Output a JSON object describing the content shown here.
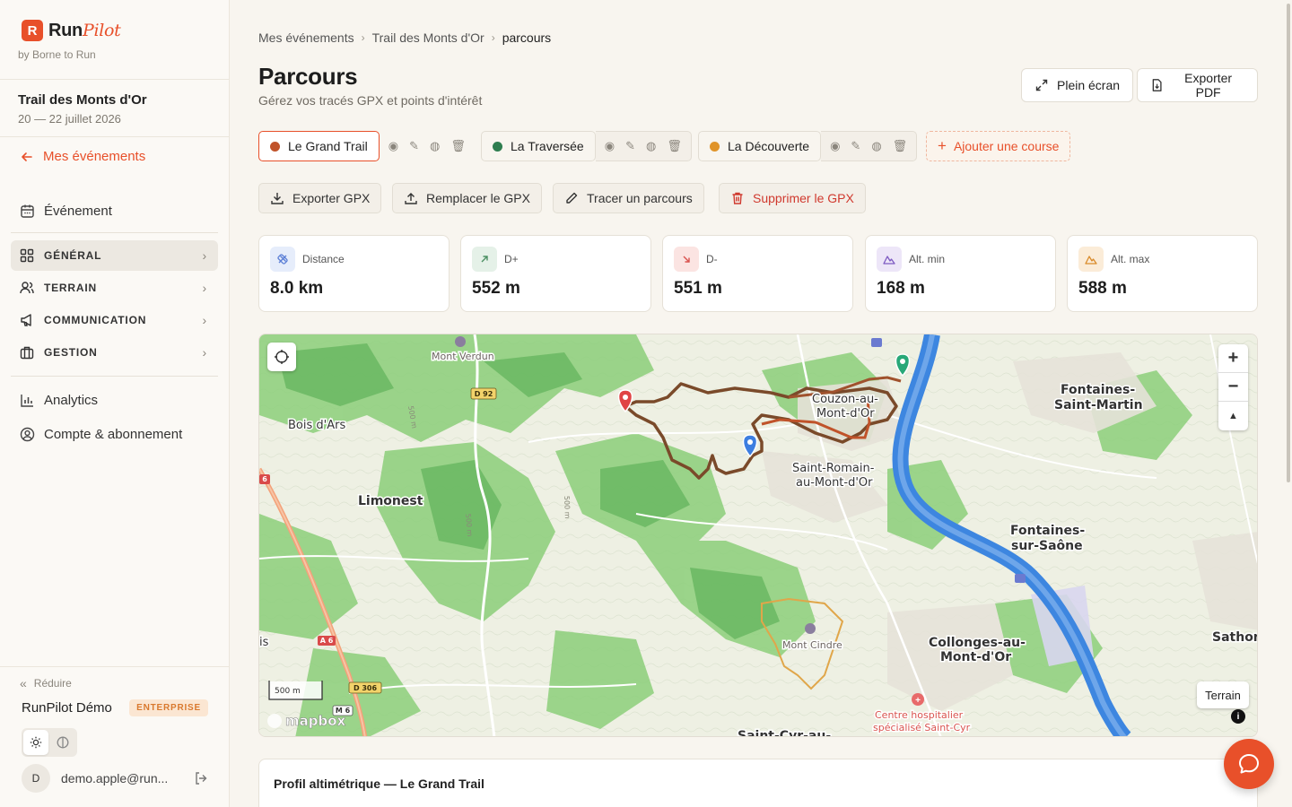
{
  "brand": {
    "logo_letter": "R",
    "name_run": "Run",
    "name_pilot": "Pilot",
    "subtitle": "by Borne to Run"
  },
  "event": {
    "name": "Trail des Monts d'Or",
    "dates": "20 — 22 juillet 2026"
  },
  "sidebar": {
    "back_label": "Mes événements",
    "event_label": "Événement",
    "sections": [
      {
        "label": "GÉNÉRAL",
        "active": true
      },
      {
        "label": "TERRAIN",
        "active": false
      },
      {
        "label": "COMMUNICATION",
        "active": false
      },
      {
        "label": "GESTION",
        "active": false
      }
    ],
    "analytics_label": "Analytics",
    "account_label": "Compte & abonnement",
    "reduce_label": "Réduire",
    "org_name": "RunPilot Démo",
    "org_plan": "ENTERPRISE",
    "user_initial": "D",
    "user_email": "demo.apple@run..."
  },
  "breadcrumb": {
    "items": [
      "Mes événements",
      "Trail des Monts d'Or"
    ],
    "current": "parcours"
  },
  "page": {
    "title": "Parcours",
    "subtitle": "Gérez vos tracés GPX et points d'intérêt"
  },
  "toolbar": {
    "fullscreen_label": "Plein écran",
    "export_pdf_label": "Exporter PDF"
  },
  "courses": [
    {
      "name": "Le Grand Trail",
      "color": "#c0532a",
      "active": true
    },
    {
      "name": "La Traversée",
      "color": "#2e7d4f",
      "active": false
    },
    {
      "name": "La Découverte",
      "color": "#e0942a",
      "active": false
    }
  ],
  "add_course_label": "Ajouter une course",
  "actions": {
    "export_gpx": "Exporter GPX",
    "replace_gpx": "Remplacer le GPX",
    "draw_route": "Tracer un parcours",
    "delete_gpx": "Supprimer le GPX"
  },
  "stats": [
    {
      "label": "Distance",
      "value": "8.0 km",
      "icon": "ruler-icon",
      "color": "#5b7fd6",
      "bg": "#e6edfb"
    },
    {
      "label": "D+",
      "value": "552 m",
      "icon": "arrow-up-right-icon",
      "color": "#4b8f62",
      "bg": "#e5f1e8"
    },
    {
      "label": "D-",
      "value": "551 m",
      "icon": "arrow-down-right-icon",
      "color": "#d9534f",
      "bg": "#fbe4e2"
    },
    {
      "label": "Alt. min",
      "value": "168 m",
      "icon": "mountain-icon",
      "color": "#7e5bc2",
      "bg": "#ede6f8"
    },
    {
      "label": "Alt. max",
      "value": "588 m",
      "icon": "mountain-icon",
      "color": "#d98b2b",
      "bg": "#fbecd8"
    }
  ],
  "map": {
    "places": {
      "mont_verdun": "Mont Verdun",
      "bois_dars": "Bois d'Ars",
      "limonest": "Limonest",
      "couzon_1": "Couzon-au-",
      "couzon_2": "Mont-d'Or",
      "saint_romain_1": "Saint-Romain-",
      "saint_romain_2": "au-Mont-d'Or",
      "fontaines_sm_1": "Fontaines-",
      "fontaines_sm_2": "Saint-Martin",
      "fontaines_ss_1": "Fontaines-",
      "fontaines_ss_2": "sur-Saône",
      "collonges_1": "Collonges-au-",
      "collonges_2": "Mont-d'Or",
      "mont_cindre": "Mont Cindre",
      "sathonay": "Sathona",
      "saint_cyr": "Saint-Cyr-au-",
      "hospital_1": "Centre hospitalier",
      "hospital_2": "spécialisé Saint-Cyr",
      "is": "is"
    },
    "road_labels": {
      "d92": "D 92",
      "a6a": "A 6",
      "a6b": "6",
      "d306": "D 306",
      "m6": "M 6",
      "c500a": "500 m",
      "c500b": "500 m",
      "c500c": "500 m"
    },
    "scale_label": "500 m",
    "attribution": "mapbox",
    "style_label": "Terrain",
    "route_color": "#a0522d",
    "secondary_route_color": "#e0a64a",
    "water_color": "#3d86e0"
  },
  "profile": {
    "title": "Profil altimétrique — Le Grand Trail"
  }
}
